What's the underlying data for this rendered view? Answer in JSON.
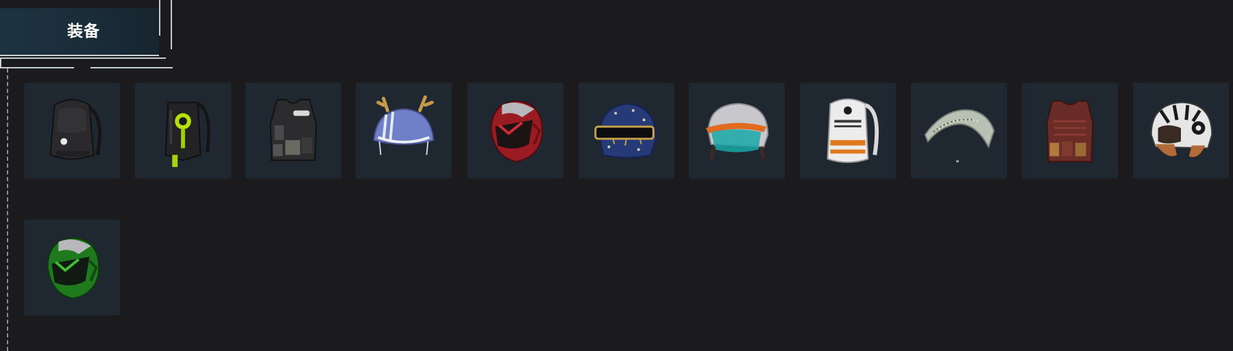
{
  "header": {
    "title": "装备"
  },
  "items": [
    {
      "icon": "black-backpack-icon"
    },
    {
      "icon": "tactical-backpack-icon"
    },
    {
      "icon": "black-vest-icon"
    },
    {
      "icon": "antler-helmet-icon"
    },
    {
      "icon": "red-motorcycle-helmet-icon"
    },
    {
      "icon": "blue-starry-helmet-icon"
    },
    {
      "icon": "white-orange-visor-helmet-icon"
    },
    {
      "icon": "snow-sports-backpack-icon"
    },
    {
      "icon": "glider-parachute-icon"
    },
    {
      "icon": "brown-plate-vest-icon"
    },
    {
      "icon": "patterned-open-face-helmet-icon"
    },
    {
      "icon": "green-motorcycle-helmet-icon"
    }
  ],
  "colors": {
    "background": "#1b1b1d",
    "tile": "#1f2830",
    "header_bg": "#1d3340",
    "header_line": "#c8d0d4"
  }
}
